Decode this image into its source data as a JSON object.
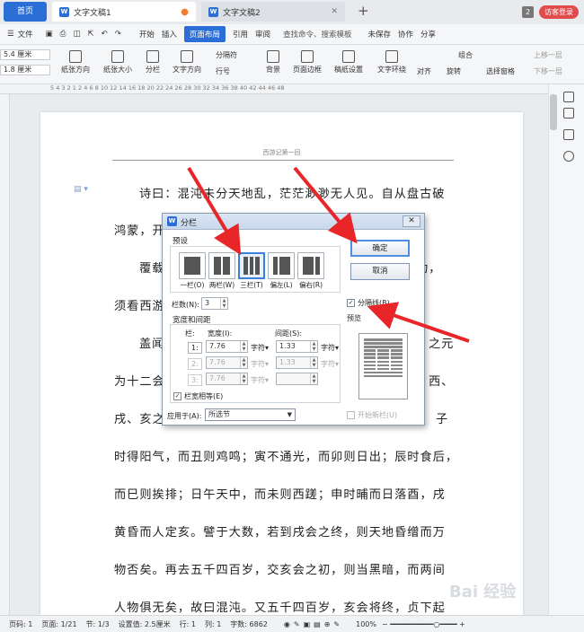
{
  "tabs": {
    "home": "首页",
    "doc1": "文字文稿1",
    "doc2": "文字文稿2",
    "count": "2",
    "login": "访客登录"
  },
  "menu": {
    "file": "文件",
    "start": "开始",
    "insert": "插入",
    "layout": "页面布局",
    "ref": "引用",
    "review": "审阅",
    "search": "查找命令、搜索模板",
    "unsaved": "未保存",
    "collab": "协作",
    "share": "分享"
  },
  "ribbon": {
    "margin1": "5.4 厘米",
    "margin2": "1.8 厘米",
    "orient": "纸张方向",
    "size": "纸张大小",
    "columns": "分栏",
    "textdir": "文字方向",
    "breaks": "分隔符",
    "lineno": "行号",
    "bg": "背景",
    "border": "页面边框",
    "grid": "稿纸设置",
    "wrap": "文字环绕",
    "align": "对齐",
    "rotate": "旋转",
    "group": "组合",
    "selpane": "选择窗格",
    "up": "上移一层",
    "down": "下移一层"
  },
  "ruler": {
    "h": "5  4  3  2  1     2  4  6  8  10  12  14  16  18  20  22  24  26  28  30  32  34  36  38  40  42  44  46  48"
  },
  "doc": {
    "header": "西游记第一回",
    "lines": [
      "诗曰：混沌未分天地乱，茫茫渺渺无人见。自从盘古破",
      "鸿蒙，开",
      "覆载",
      "功，",
      "须看西游",
      "盖闻",
      "之元",
      "为十二会",
      "西、",
      "戌、亥之",
      "子",
      "时得阳气，而丑则鸡鸣；寅不通光，而卯则日出；辰时食后，",
      "而巳则挨排；日午天中，而未则西蹉；申时晡而日落酉，戌",
      "黄昏而人定亥。譬于大数，若到戌会之终，则天地昏缯而万",
      "物否矣。再去五千四百岁，交亥会之初，则当黑暗，而两间",
      "人物俱无矣，故曰混沌。又五千四百岁，亥会将终，贞下起"
    ]
  },
  "dialog": {
    "title": "分栏",
    "preset_group": "预设",
    "presets": [
      "一栏(O)",
      "两栏(W)",
      "三栏(T)",
      "偏左(L)",
      "偏右(R)"
    ],
    "ok": "确定",
    "cancel": "取消",
    "divider": "分隔线(B)",
    "preview": "预览",
    "colnum_label": "栏数(N):",
    "colnum": "3",
    "width_group": "宽度和间距",
    "col_label": "栏:",
    "width_label": "宽度(I):",
    "spacing_label": "间距(S):",
    "rows": [
      {
        "n": "1:",
        "w": "7.76",
        "s": "1.33"
      },
      {
        "n": "2:",
        "w": "7.76",
        "s": "1.33"
      },
      {
        "n": "3:",
        "w": "7.76",
        "s": ""
      }
    ],
    "unit": "字符",
    "equal": "栏宽相等(E)",
    "apply_label": "应用于(A):",
    "apply_value": "所选节",
    "newcol": "开始新栏(U)",
    "check": "✓"
  },
  "status": {
    "page": "页码: 1",
    "pages": "页面: 1/21",
    "section": "节: 1/3",
    "setting": "设置值: 2.5厘米",
    "row": "行: 1",
    "col": "列: 1",
    "words": "字数: 6862",
    "zoom": "100%"
  },
  "watermark": "Bai 经验"
}
